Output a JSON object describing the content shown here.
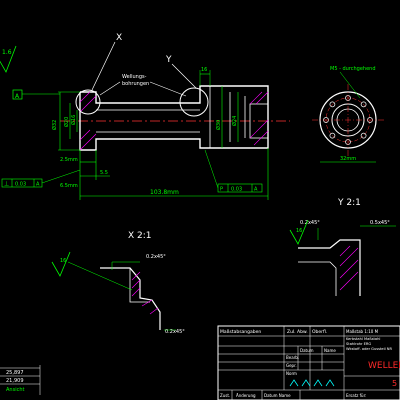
{
  "main_view": {
    "roughness_left": "1.6",
    "label_x": "X",
    "label_y": "Y",
    "welding_note_line1": "Wellungs-",
    "welding_note_line2": "bohrungen",
    "dim_16": "16",
    "dim_len": "103.8mm",
    "dim_25": "2.5mm",
    "dim_55": "5.5",
    "dim_6": "6.5mm",
    "dim_phi_big": "Ø32",
    "dim_phi_2": "Ø20",
    "dim_phi_3": "Ø16",
    "dim_phi_4": "Ø30",
    "dim_phi_5": "Ø24",
    "tol_left_1": "⊥",
    "tol_left_2": "0.03",
    "tol_left_3": "A",
    "tol_right_1": "P",
    "tol_right_2": "0.03",
    "tol_right_3": "A",
    "datum_a": "A"
  },
  "end_view": {
    "note": "M5 - durchgehend",
    "dim_bottom": "32mm"
  },
  "detail_x": {
    "title": "X 2:1",
    "r1": "0.2x45°",
    "r2": "0.2x45°",
    "rough": "16"
  },
  "detail_y": {
    "title": "Y 2:1",
    "r1": "0.2x45°",
    "r2": "0.5x45°",
    "rough": "16"
  },
  "side_values": {
    "v1": "25,897",
    "v2": "21,909",
    "v3": "Ansicht"
  },
  "title_block": {
    "header_left": "Maßstabsangaben",
    "header_mid": "Zul. Abw.",
    "header_right": "Oberfl.",
    "material": "Maßstab 1:10 M",
    "material2": "Kerbstahl Maßstahl",
    "material3": "Stahlrohr ERG",
    "material4": "Wkstoff. oder Gussteil NR",
    "row_datum": "Datum",
    "row_name": "Name",
    "row_bearb": "Bearb.",
    "row_gepr": "Gepr.",
    "row_norm": "Norm",
    "title": "WELLEN",
    "sheet": "5",
    "footer_1": "Zust.",
    "footer_2": "Änderung",
    "footer_3": "Datum Name",
    "footer_right": "Ersatz für:"
  },
  "colors": {
    "background": "#000000",
    "outline": "#ffffff",
    "dimension": "#00ff00",
    "centerline": "#ff3333",
    "hatch": "#ff00ff",
    "text": "#ffff00",
    "accent": "#00ffff",
    "title_red": "#ff2a2a"
  }
}
